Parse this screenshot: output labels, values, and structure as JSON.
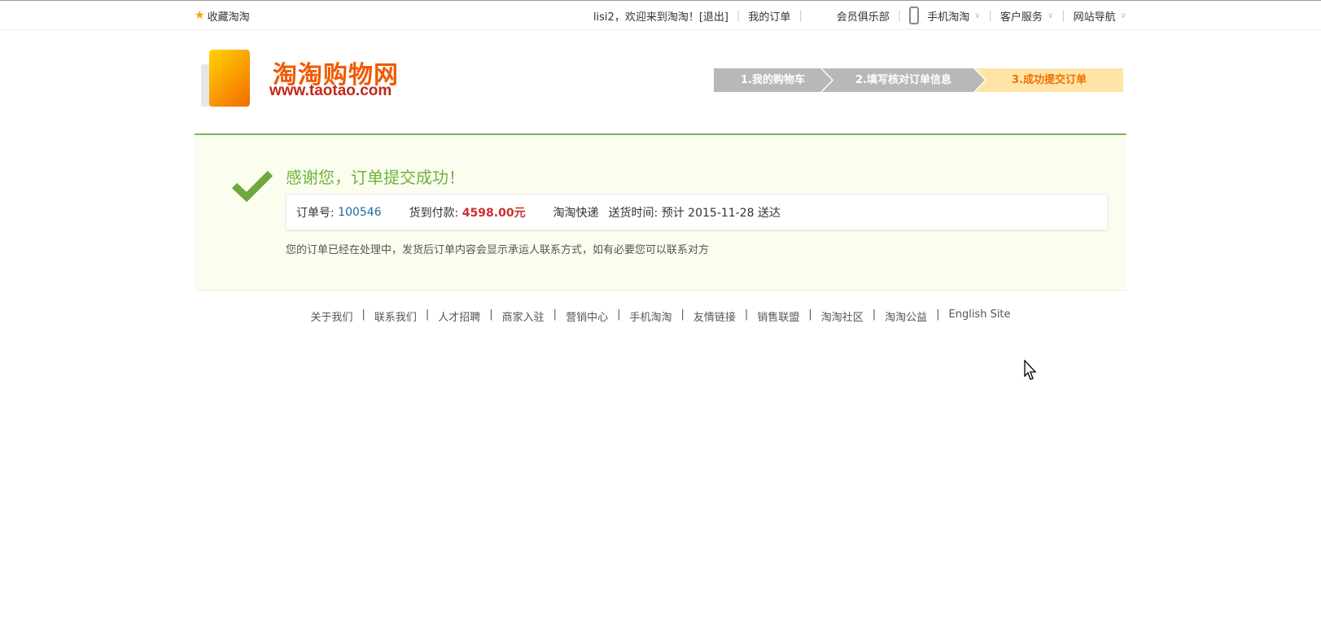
{
  "topbar": {
    "favorite": "收藏淘淘",
    "welcome": "lisi2，欢迎来到淘淘！",
    "logout": "[退出]",
    "my_orders": "我的订单",
    "member_club": "会员俱乐部",
    "mobile": "手机淘淘",
    "service": "客户服务",
    "site_nav": "网站导航"
  },
  "logo": {
    "cn": "淘淘购物网",
    "en": "www.taotao.com"
  },
  "steps": [
    "1.我的购物车",
    "2.填写核对订单信息",
    "3.成功提交订单"
  ],
  "success": {
    "title": "感谢您，订单提交成功！",
    "order_label": "订单号:",
    "order_id": "100546",
    "pay_label": "货到付款:",
    "amount": "4598.00元",
    "courier": "淘淘快递",
    "delivery_label": "送货时间:",
    "delivery": "预计 2015-11-28 送达",
    "note": "您的订单已经在处理中，发货后订单内容会显示承运人联系方式，如有必要您可以联系对方"
  },
  "footer": [
    "关于我们",
    "联系我们",
    "人才招聘",
    "商家入驻",
    "营销中心",
    "手机淘淘",
    "友情链接",
    "销售联盟",
    "淘淘社区",
    "淘淘公益",
    "English Site"
  ],
  "colors": {
    "accent_green": "#7ab55c",
    "price_red": "#c9302c",
    "step_active": "#f07000"
  }
}
